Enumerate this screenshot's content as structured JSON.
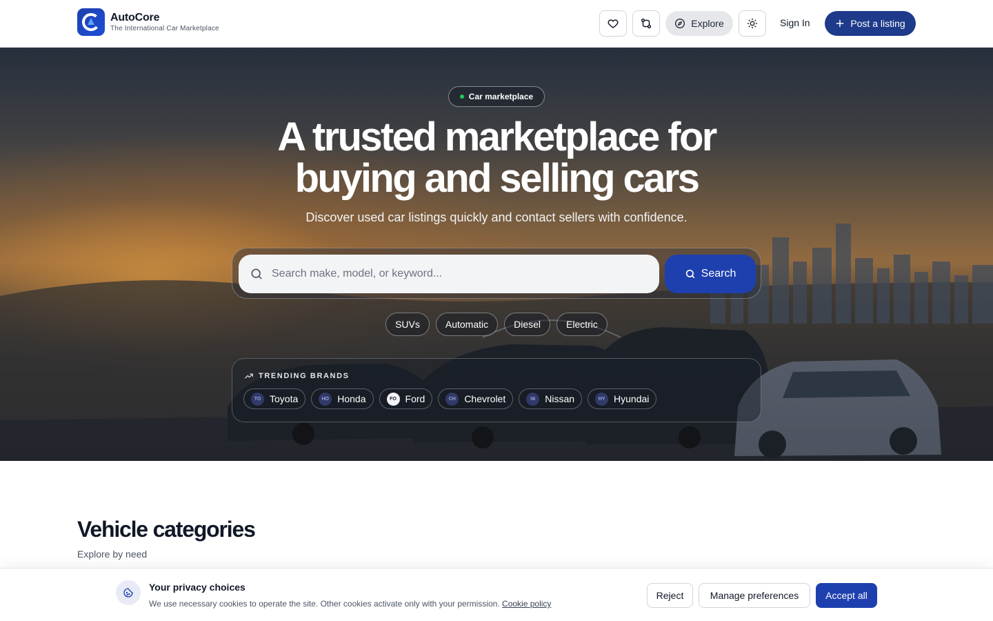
{
  "header": {
    "brand_name": "AutoCore",
    "brand_tagline": "The International Car Marketplace",
    "explore_label": "Explore",
    "signin_label": "Sign In",
    "post_label": "Post a listing"
  },
  "hero": {
    "badge": "Car marketplace",
    "title_line1": "A trusted marketplace for",
    "title_line2": "buying and selling cars",
    "subtitle": "Discover used car listings quickly and contact sellers with confidence.",
    "search_placeholder": "Search make, model, or keyword...",
    "search_button": "Search",
    "quick_filters": [
      "SUVs",
      "Automatic",
      "Diesel",
      "Electric"
    ],
    "trending_heading": "TRENDING BRANDS",
    "brands": [
      {
        "name": "Toyota",
        "abbr": "TO"
      },
      {
        "name": "Honda",
        "abbr": "HO"
      },
      {
        "name": "Ford",
        "abbr": "FO"
      },
      {
        "name": "Chevrolet",
        "abbr": "CH"
      },
      {
        "name": "Nissan",
        "abbr": "NI"
      },
      {
        "name": "Hyundai",
        "abbr": "HY"
      }
    ]
  },
  "categories": {
    "title": "Vehicle categories",
    "subtitle": "Explore by need"
  },
  "cookie": {
    "title": "Your privacy choices",
    "text": "We use necessary cookies to operate the site. Other cookies activate only with your permission.",
    "link": "Cookie policy",
    "reject": "Reject",
    "manage": "Manage preferences",
    "accept": "Accept all"
  },
  "colors": {
    "primary": "#1e40af",
    "primary_dark": "#1e3a8a",
    "status_dot": "#22c55e"
  },
  "icons": {
    "favorites": "heart-icon",
    "compare": "compare-icon",
    "explore": "compass-icon",
    "theme": "sun-icon",
    "post": "plus-icon",
    "search": "search-icon",
    "trending": "trending-up-icon",
    "cookie": "cookie-icon"
  }
}
